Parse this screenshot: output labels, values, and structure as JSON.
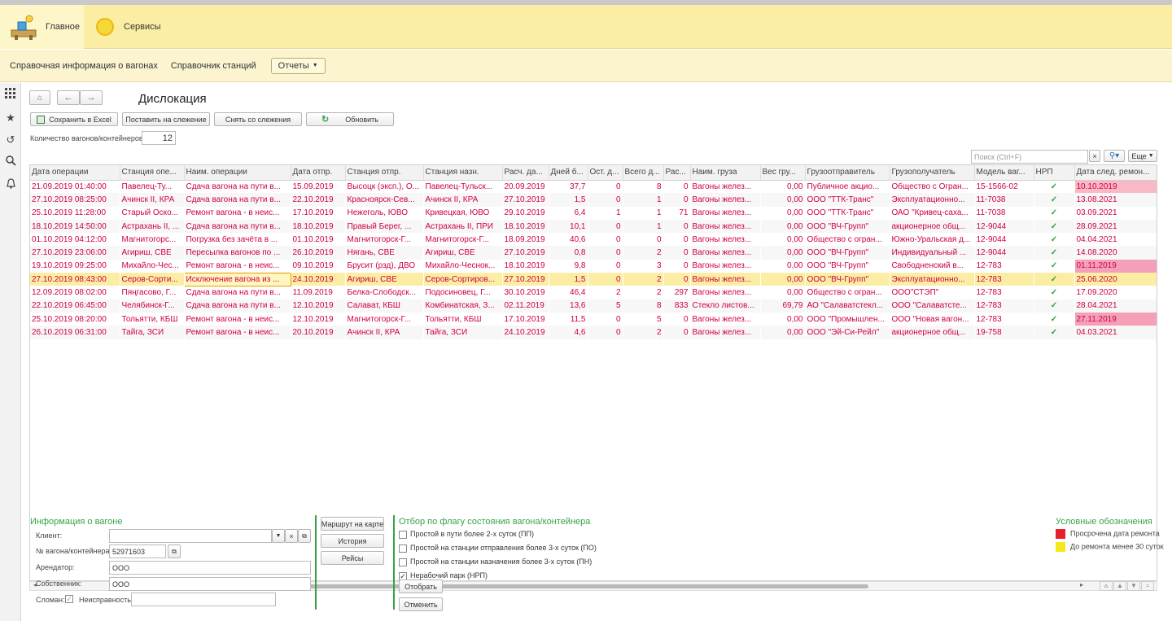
{
  "sections": [
    {
      "label": "Главное"
    },
    {
      "label": "Сервисы"
    }
  ],
  "nav": {
    "link1": "Справочная информация о вагонах",
    "link2": "Справочник станций",
    "reports": "Отчеты"
  },
  "form": {
    "title": "Дислокация",
    "buttons": {
      "save_excel": "Сохранить в Excel",
      "track_on": "Поставить на слежение",
      "track_off": "Снять со слежения",
      "refresh": "Обновить"
    },
    "count_label": "Количество вагонов/контейнеров:",
    "count_value": "12",
    "search_placeholder": "Поиск (Ctrl+F)",
    "more": "Еще"
  },
  "table": {
    "columns": [
      "Дата операции",
      "Станция опе...",
      "Наим. операции",
      "Дата отпр.",
      "Станция отпр.",
      "Станция назн.",
      "Расч. да...",
      "Дней б...",
      "Ост. д...",
      "Всего д...",
      "Рас...",
      "Наим. груза",
      "Вес гру...",
      "Грузоотправитель",
      "Грузополучатель",
      "Модель ваг...",
      "НРП",
      "Дата след. ремон..."
    ],
    "rows": [
      [
        "21.09.2019 01:40:00",
        "Павелец-Ту...",
        "Сдача вагона на пути в...",
        "15.09.2019",
        "Высоцк (эксп.), О...",
        "Павелец-Тульск...",
        "20.09.2019",
        "37,7",
        "0",
        "8",
        "0",
        "Вагоны желез...",
        "0,00",
        "Публичное акцио...",
        "Общество с Огран...",
        "15-1566-02",
        "✓",
        "10.10.2019"
      ],
      [
        "27.10.2019 08:25:00",
        "Ачинск II, КРА",
        "Сдача вагона на пути в...",
        "22.10.2019",
        "Красноярск-Сев...",
        "Ачинск II, КРА",
        "27.10.2019",
        "1,5",
        "0",
        "1",
        "0",
        "Вагоны желез...",
        "0,00",
        "ООО \"ТТК-Транс\"",
        "Эксплуатационно...",
        "11-7038",
        "✓",
        "13.08.2021"
      ],
      [
        "25.10.2019 11:28:00",
        "Старый Оско...",
        "Ремонт вагона - в неис...",
        "17.10.2019",
        "Нежеголь, ЮВО",
        "Кривецкая, ЮВО",
        "29.10.2019",
        "6,4",
        "1",
        "1",
        "71",
        "Вагоны желез...",
        "0,00",
        "ООО \"ТТК-Транс\"",
        "ОАО \"Кривец-саха...",
        "11-7038",
        "✓",
        "03.09.2021"
      ],
      [
        "18.10.2019 14:50:00",
        "Астрахань II, ...",
        "Сдача вагона на пути в...",
        "18.10.2019",
        "Правый Берег, ...",
        "Астрахань II, ПРИ",
        "18.10.2019",
        "10,1",
        "0",
        "1",
        "0",
        "Вагоны желез...",
        "0,00",
        "ООО \"ВЧ-Групп\"",
        "акционерное общ...",
        "12-9044",
        "✓",
        "28.09.2021"
      ],
      [
        "01.10.2019 04:12:00",
        "Магнитогорс...",
        "Погрузка без зачёта в ...",
        "01.10.2019",
        "Магнитогорск-Г...",
        "Магнитогорск-Г...",
        "18.09.2019",
        "40,6",
        "0",
        "0",
        "0",
        "Вагоны желез...",
        "0,00",
        "Общество с огран...",
        "Южно-Уральская д...",
        "12-9044",
        "✓",
        "04.04.2021"
      ],
      [
        "27.10.2019 23:06:00",
        "Агириш, СВЕ",
        "Пересылка вагонов по ...",
        "26.10.2019",
        "Нягань, СВЕ",
        "Агириш, СВЕ",
        "27.10.2019",
        "0,8",
        "0",
        "2",
        "0",
        "Вагоны желез...",
        "0,00",
        "ООО \"ВЧ-Групп\"",
        "Индивидуальный ...",
        "12-9044",
        "✓",
        "14.08.2020"
      ],
      [
        "19.10.2019 09:25:00",
        "Михайло-Чес...",
        "Ремонт вагона - в неис...",
        "09.10.2019",
        "Брусит (рзд), ДВО",
        "Михайло-Чеснок...",
        "18.10.2019",
        "9,8",
        "0",
        "3",
        "0",
        "Вагоны желез...",
        "0,00",
        "ООО \"ВЧ-Групп\"",
        "Свободненский в...",
        "12-783",
        "✓",
        "01.11.2019"
      ],
      [
        "27.10.2019 08:43:00",
        "Серов-Сорти...",
        "Исключение вагона из ...",
        "24.10.2019",
        "Агириш, СВЕ",
        "Серов-Сортиров...",
        "27.10.2019",
        "1,5",
        "0",
        "2",
        "0",
        "Вагоны желез...",
        "0,00",
        "ООО \"ВЧ-Групп\"",
        "Эксплуатационно...",
        "12-783",
        "✓",
        "25.06.2020"
      ],
      [
        "12.09.2019 08:02:00",
        "Пяңгасово, Г...",
        "Сдача вагона на пути в...",
        "11.09.2019",
        "Белка-Слободск...",
        "Подосиновец, Г...",
        "30.10.2019",
        "46,4",
        "2",
        "2",
        "297",
        "Вагоны желез...",
        "0,00",
        "Общество с огран...",
        "ООО\"СТЭП\"",
        "12-783",
        "✓",
        "17.09.2020"
      ],
      [
        "22.10.2019 06:45:00",
        "Челябинск-Г...",
        "Сдача вагона на пути в...",
        "12.10.2019",
        "Салават, КБШ",
        "Комбинатская, З...",
        "02.11.2019",
        "13,6",
        "5",
        "8",
        "833",
        "Стекло листов...",
        "69,79",
        "АО \"Салаватстекл...",
        "ООО \"Салаватсте...",
        "12-783",
        "✓",
        "28.04.2021"
      ],
      [
        "25.10.2019 08:20:00",
        "Тольятти, КБШ",
        "Ремонт вагона - в неис...",
        "12.10.2019",
        "Магнитогорск-Г...",
        "Тольятти, КБШ",
        "17.10.2019",
        "11,5",
        "0",
        "5",
        "0",
        "Вагоны желез...",
        "0,00",
        "ООО \"Промышлен...",
        "ООО \"Новая вагон...",
        "12-783",
        "✓",
        "27.11.2019"
      ],
      [
        "26.10.2019 06:31:00",
        "Тайга, ЗСИ",
        "Ремонт вагона - в неис...",
        "20.10.2019",
        "Ачинск II, КРА",
        "Тайга, ЗСИ",
        "24.10.2019",
        "4,6",
        "0",
        "2",
        "0",
        "Вагоны желез...",
        "0,00",
        "ООО \"Эй-Си-Рейл\"",
        "акционерное общ...",
        "19-758",
        "✓",
        "04.03.2021"
      ]
    ]
  },
  "info": {
    "title": "Информация о вагоне",
    "client_label": "Клиент:",
    "client_value": "",
    "wagon_label": "№ вагона/контейнера:",
    "wagon_value": "52971603",
    "renter_label": "Арендатор:",
    "renter_value": "ООО",
    "owner_label": "Собственник:",
    "owner_value": "ООО",
    "broken_label": "Сломан:",
    "fault_label": "Неисправность:",
    "fault_value": ""
  },
  "side_buttons": {
    "route": "Маршрут на карте",
    "history": "История",
    "trips": "Рейсы"
  },
  "filter": {
    "title": "Отбор по флагу состояния вагона/контейнера",
    "options": [
      "Простой в пути более 2-х суток (ПП)",
      "Простой на станции отправления более 3-х суток (ПО)",
      "Простой на станции назначения более 3-х суток (ПН)",
      "Нерабочий парк (НРП)"
    ],
    "apply": "Отобрать",
    "cancel": "Отменить"
  },
  "legend": {
    "title": "Условные обозначения",
    "items": [
      {
        "label": "Просрочена дата ремонта",
        "color": "#e8202a"
      },
      {
        "label": "До ремонта менее 30 суток",
        "color": "#f6e71c"
      }
    ]
  }
}
